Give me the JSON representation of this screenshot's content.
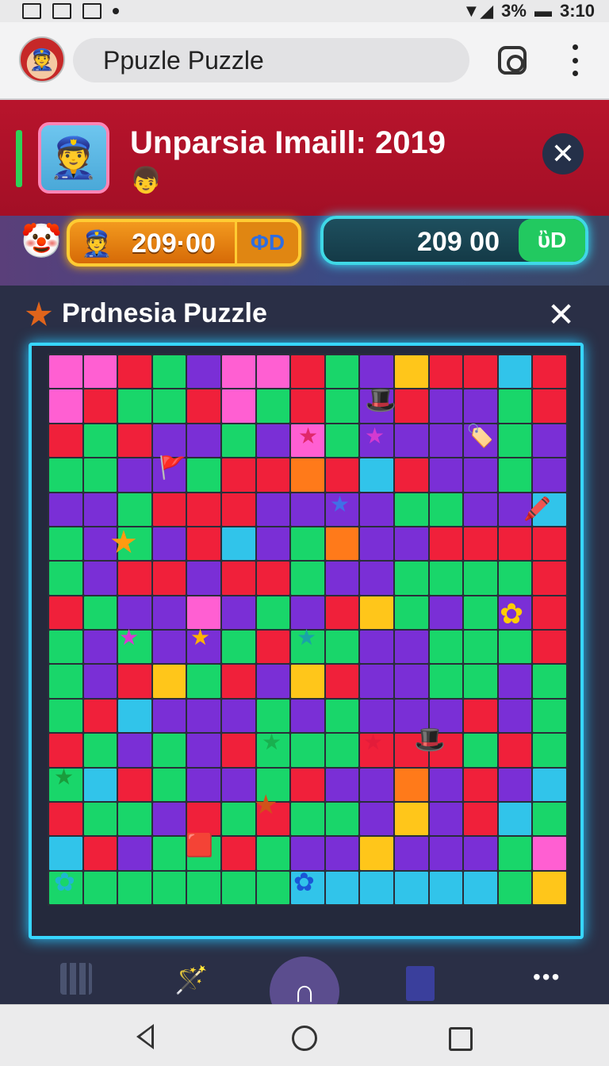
{
  "status_bar": {
    "battery": "3%",
    "time": "3:10"
  },
  "top_bar": {
    "search_text": "Ppuzle Puzzle"
  },
  "banner": {
    "title": "Unparsia Imaill: 2019",
    "close_glyph": "✕"
  },
  "currency": {
    "coins_value": "209·00",
    "coins_suffix": "ΦD",
    "gems_value": "209 00",
    "gems_suffix": "ὒD"
  },
  "panel": {
    "title": "Prdnesia Puzzle",
    "close_glyph": "✕"
  },
  "board": {
    "columns": 15,
    "rows": 16,
    "colors": {
      "R": "#f0203a",
      "G": "#19d66a",
      "P": "#7a2fd6",
      "M": "#ff5fd2",
      "Y": "#ffc61a",
      "C": "#31c4ea",
      "O": "#ff7a1a"
    },
    "grid": [
      "MMRGPMMRGPYRRCR",
      "MRGGRMGRGPRPPGR",
      "RGRPPGPMGPPPPGP",
      "GGPPGRRORCRPPGP",
      "PPGRRRPPPPGGPPC",
      "GPGPRCPGOPPRRRR",
      "GPRRPRRGPPGGGGR",
      "RGPPMPGPRYGPGPR",
      "GPGPPGRGGPPGGGR",
      "GPRYGRPYRPPGGPG",
      "GRCPPPGPGPPPRPG",
      "RGPGPRGGGRRRGRG",
      "GCRGPPGRPPOPRPC",
      "RGGPRGRGGPYPRCG",
      "CRPGGRGPPYPPPGM",
      "GGGGGGGCCCCCCGY"
    ]
  },
  "tabs": {
    "center_glyph": "∩"
  }
}
